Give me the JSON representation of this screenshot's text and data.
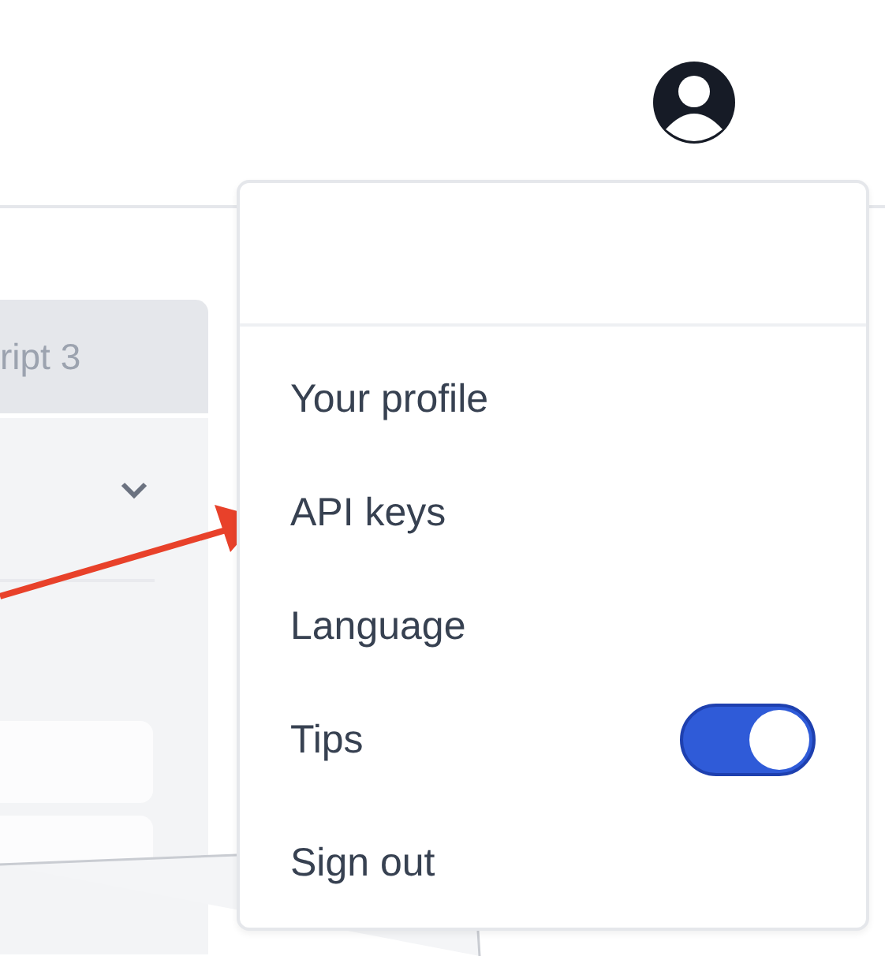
{
  "background_tab": {
    "label": "ript 3"
  },
  "menu": {
    "items": [
      {
        "kind": "link",
        "label": "Your profile"
      },
      {
        "kind": "link",
        "label": "API keys"
      },
      {
        "kind": "link",
        "label": "Language"
      },
      {
        "kind": "toggle",
        "label": "Tips",
        "on": true
      },
      {
        "kind": "link",
        "label": "Sign out"
      }
    ]
  }
}
